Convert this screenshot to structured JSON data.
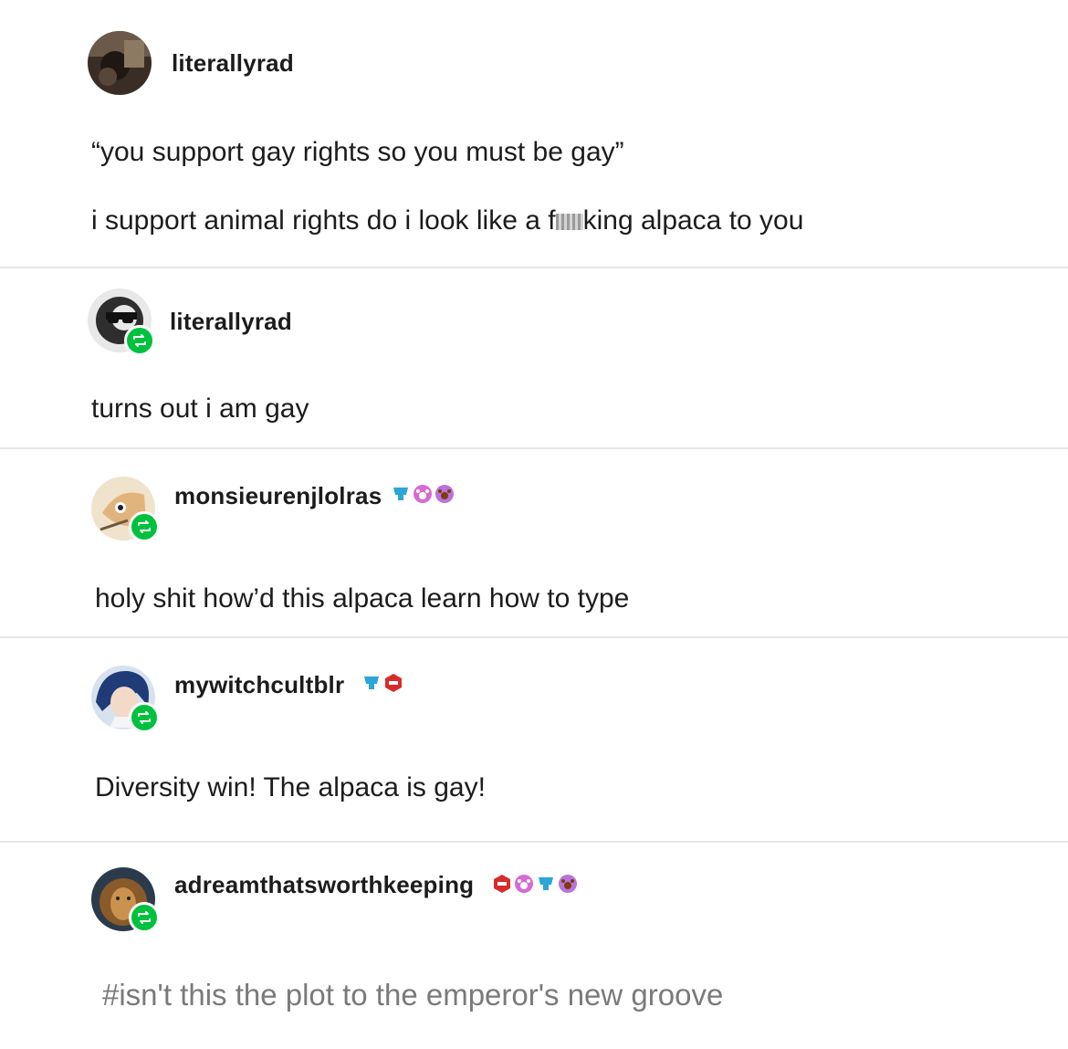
{
  "posts": [
    {
      "username": "literallyrad",
      "lines": [
        "“you support gay rights so you must be gay”",
        "i support animal rights do i look like a f"
      ],
      "censored_tail": "king alpaca to you",
      "reblog": false
    },
    {
      "username": "literallyrad",
      "lines": [
        "turns out i am gay"
      ],
      "reblog": true
    },
    {
      "username": "monsieurenjlolras",
      "lines": [
        "holy shit how’d this alpaca learn how to type"
      ],
      "reblog": true,
      "badges": [
        "cup-badge-icon",
        "paw-pink-badge-icon",
        "paw-brown-badge-icon"
      ]
    },
    {
      "username": "mywitchcultblr",
      "lines": [
        "Diversity win! The alpaca is gay!"
      ],
      "reblog": true,
      "badges": [
        "cup-badge-icon",
        "red-hexagon-badge-icon"
      ]
    },
    {
      "username": "adreamthatsworthkeeping",
      "lines": [],
      "reblog": true,
      "badges": [
        "red-hexagon-badge-icon",
        "paw-pink-badge-icon",
        "cup-badge-icon",
        "paw-brown-badge-icon"
      ],
      "tag": "#isn't this the plot to the emperor's new groove"
    }
  ],
  "colors": {
    "reblog_green": "#00c13d",
    "divider": "#e6e6e6",
    "tag_gray": "#7a7a7a"
  }
}
